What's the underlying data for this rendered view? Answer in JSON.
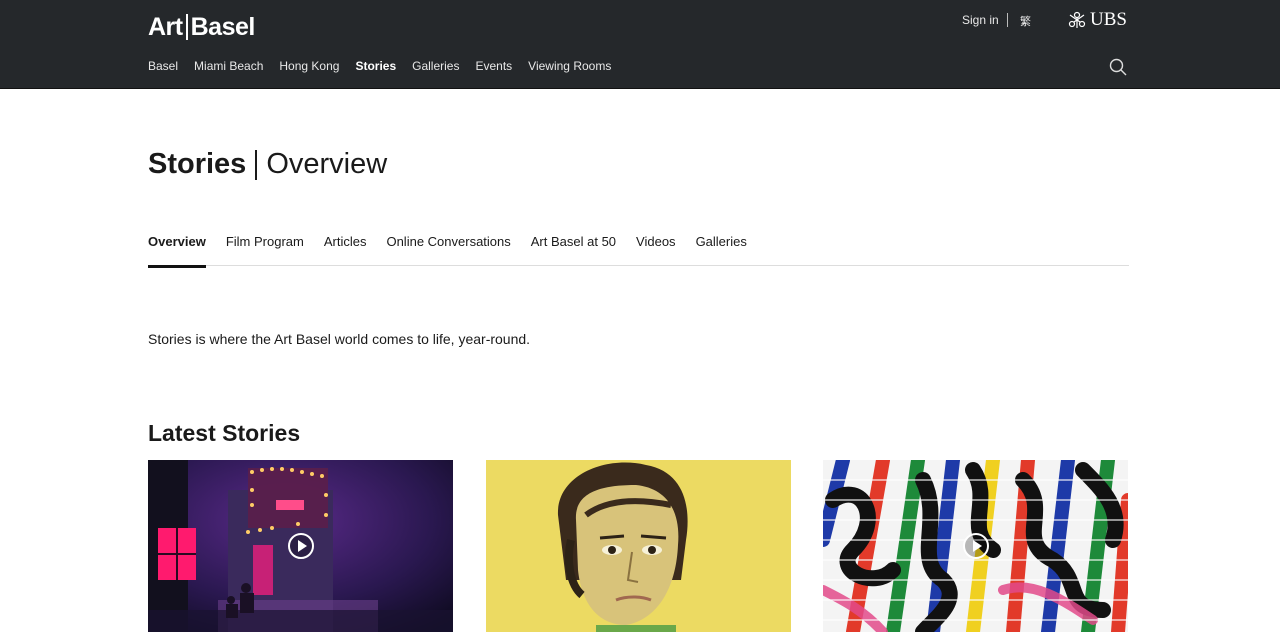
{
  "header": {
    "logo": {
      "left": "Art",
      "right": "Basel"
    },
    "nav": [
      "Basel",
      "Miami Beach",
      "Hong Kong",
      "Stories",
      "Galleries",
      "Events",
      "Viewing Rooms"
    ],
    "active_nav": "Stories",
    "sign_in": "Sign in",
    "language": "繁",
    "sponsor": "UBS"
  },
  "page": {
    "title": "Stories",
    "subtitle": "Overview",
    "tabs": [
      "Overview",
      "Film Program",
      "Articles",
      "Online Conversations",
      "Art Basel at 50",
      "Videos",
      "Galleries"
    ],
    "active_tab": "Overview",
    "intro": "Stories is where the Art Basel world comes to life, year-round.",
    "latest_title": "Latest Stories"
  },
  "cards": [
    {
      "kind": "video",
      "scene": "night building with neon lights"
    },
    {
      "kind": "image",
      "scene": "portrait painting on yellow background"
    },
    {
      "kind": "video",
      "scene": "colorful abstract stripes"
    }
  ],
  "colors": {
    "header_bg": "#25282b",
    "text": "#1a1a1a"
  }
}
